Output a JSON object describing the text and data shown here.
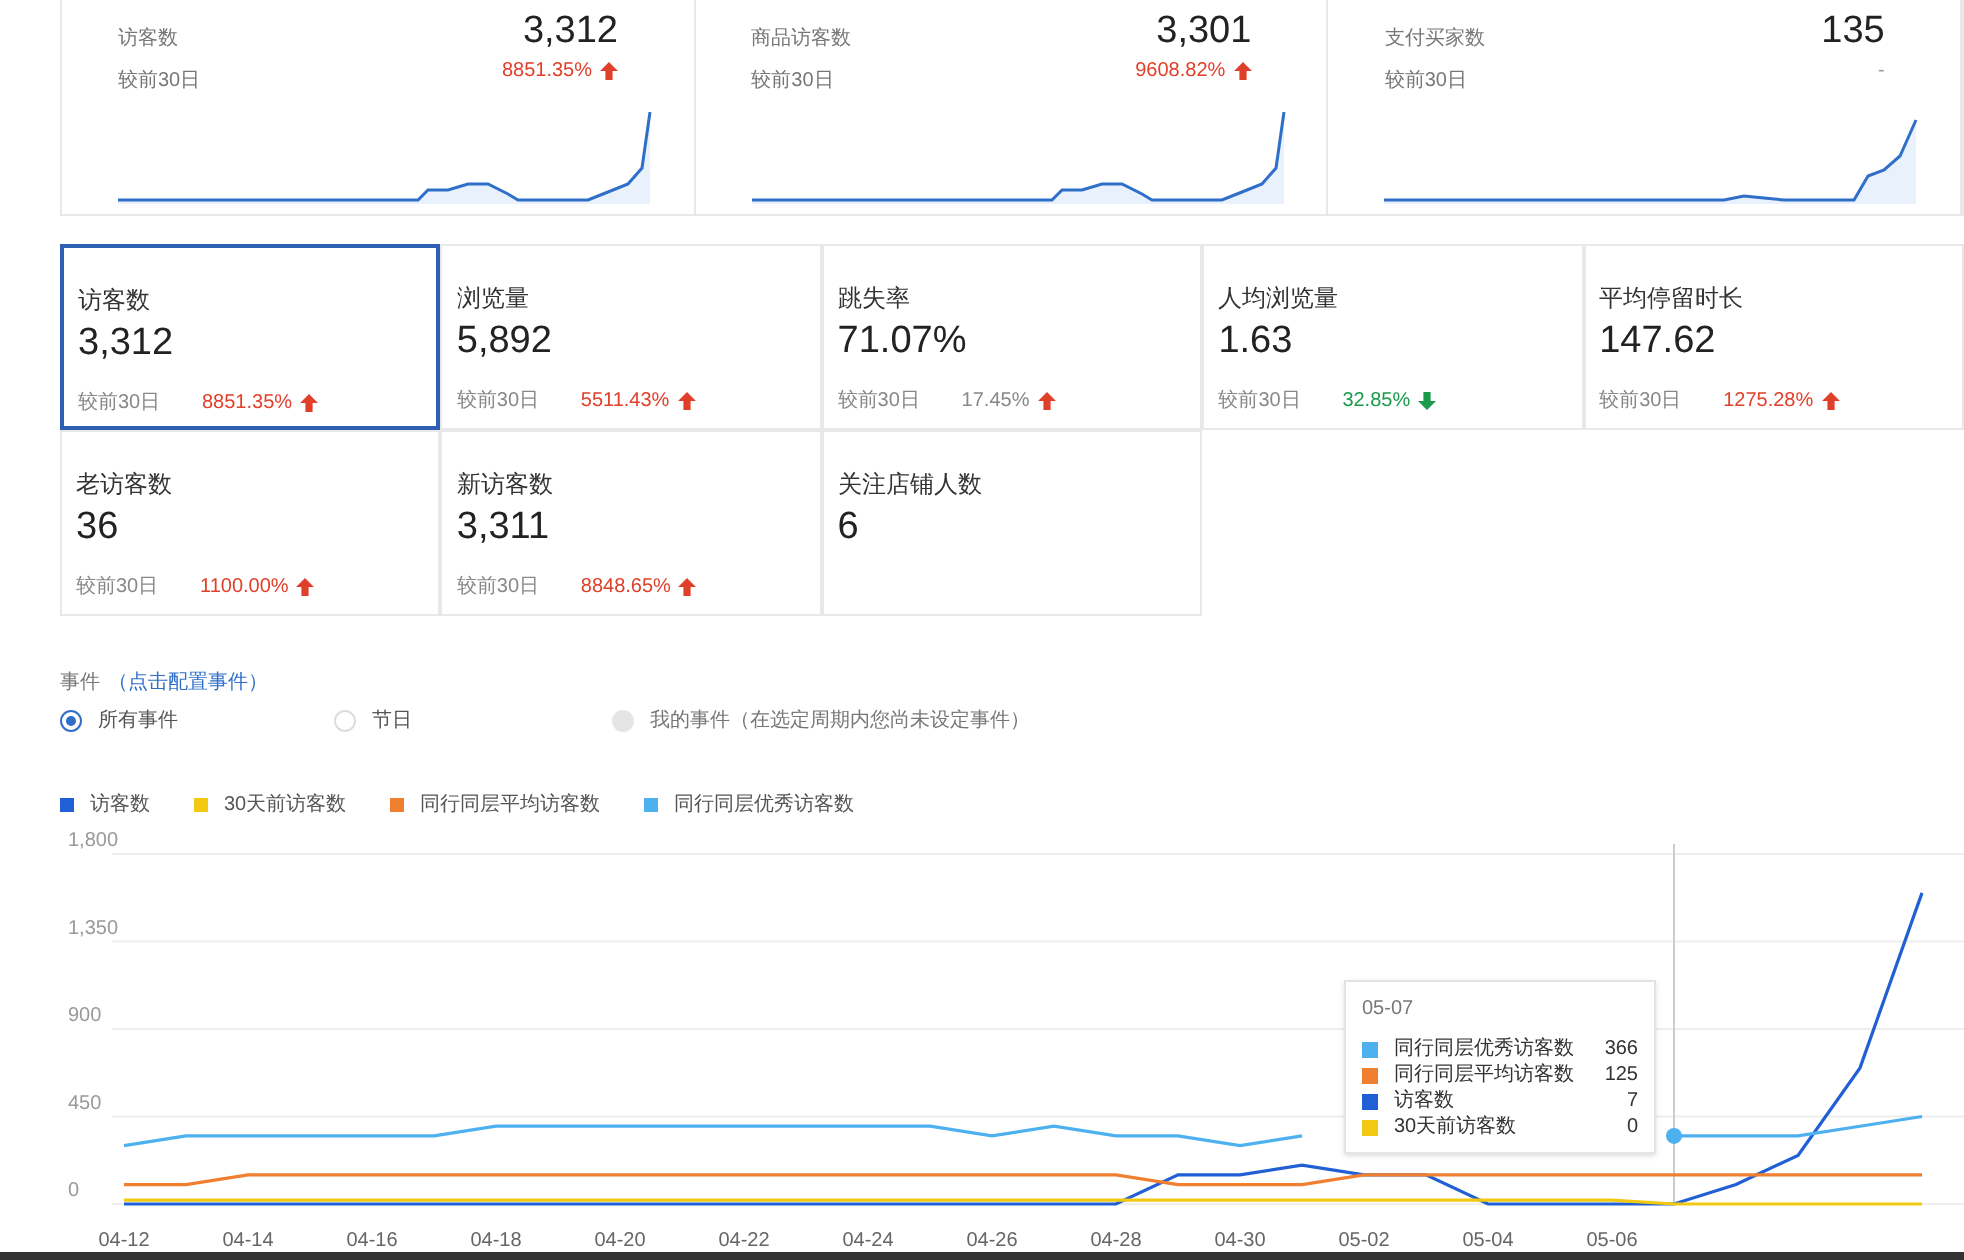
{
  "summary_cards": [
    {
      "label": "访客数",
      "value": "3,312",
      "compare_label": "较前30日",
      "change": "8851.35%",
      "increase": true
    },
    {
      "label": "商品访客数",
      "value": "3,301",
      "compare_label": "较前30日",
      "change": "9608.82%",
      "increase": true
    },
    {
      "label": "支付买家数",
      "value": "135",
      "compare_label": "较前30日",
      "change": "-"
    }
  ],
  "metrics": [
    {
      "label": "访客数",
      "value": "3,312",
      "compare_label": "较前30日",
      "change": "8851.35%",
      "increase": true,
      "color": "#e0402a",
      "selected": true
    },
    {
      "label": "浏览量",
      "value": "5,892",
      "compare_label": "较前30日",
      "change": "5511.43%",
      "increase": true,
      "color": "#e0402a",
      "selected": false
    },
    {
      "label": "跳失率",
      "value": "71.07%",
      "compare_label": "较前30日",
      "change": "17.45%",
      "increase": true,
      "color": "#888888",
      "selected": false
    },
    {
      "label": "人均浏览量",
      "value": "1.63",
      "compare_label": "较前30日",
      "change": "32.85%",
      "increase": false,
      "color": "#1a9a4a",
      "selected": false
    },
    {
      "label": "平均停留时长",
      "value": "147.62",
      "compare_label": "较前30日",
      "change": "1275.28%",
      "increase": true,
      "color": "#e0402a",
      "selected": false
    },
    {
      "label": "老访客数",
      "value": "36",
      "compare_label": "较前30日",
      "change": "1100.00%",
      "increase": true,
      "color": "#e0402a",
      "selected": false
    },
    {
      "label": "新访客数",
      "value": "3,311",
      "compare_label": "较前30日",
      "change": "8848.65%",
      "increase": true,
      "color": "#e0402a",
      "selected": false
    },
    {
      "label": "关注店铺人数",
      "value": "6",
      "selected": false
    }
  ],
  "events": {
    "title": "事件",
    "link": "（点击配置事件）",
    "options": [
      {
        "label": "所有事件",
        "selected": true,
        "disabled": false
      },
      {
        "label": "节日",
        "selected": false,
        "disabled": false
      },
      {
        "label": "我的事件（在选定周期内您尚未设定事件）",
        "selected": false,
        "disabled": true
      }
    ]
  },
  "chart": {
    "chart_data": {
      "type": "line",
      "grid": true,
      "categories": [
        "04-12",
        null,
        "04-14",
        null,
        "04-16",
        null,
        "04-18",
        null,
        "04-20",
        null,
        "04-22",
        null,
        "04-24",
        null,
        "04-26",
        null,
        "04-28",
        null,
        "04-30",
        null,
        "05-02",
        null,
        "05-04",
        null,
        "05-06",
        null,
        null,
        null,
        null,
        null
      ],
      "series": [
        {
          "name": "访客数",
          "color": "#2160d4",
          "values": [
            0,
            0,
            0,
            0,
            0,
            0,
            0,
            0,
            0,
            0,
            0,
            0,
            0,
            0,
            0,
            0,
            0,
            150,
            150,
            200,
            150,
            150,
            0,
            0,
            0,
            0,
            100,
            250,
            700,
            1600
          ]
        },
        {
          "name": "30天前访客数",
          "color": "#f2c811",
          "values": [
            20,
            20,
            20,
            20,
            20,
            20,
            20,
            20,
            20,
            20,
            20,
            20,
            20,
            20,
            20,
            20,
            20,
            20,
            20,
            20,
            20,
            20,
            20,
            20,
            20,
            0,
            0,
            0,
            0,
            0
          ]
        },
        {
          "name": "同行同层平均访客数",
          "color": "#f08030",
          "values": [
            100,
            100,
            150,
            150,
            150,
            150,
            150,
            150,
            150,
            150,
            150,
            150,
            150,
            150,
            150,
            150,
            150,
            100,
            100,
            100,
            150,
            150,
            150,
            150,
            150,
            150,
            150,
            150,
            150,
            150
          ]
        },
        {
          "name": "同行同层优秀访客数",
          "color": "#4db1ef",
          "values": [
            300,
            350,
            350,
            350,
            350,
            350,
            400,
            400,
            400,
            400,
            400,
            400,
            400,
            400,
            350,
            400,
            350,
            350,
            300,
            350,
            null,
            null,
            null,
            null,
            null,
            350,
            350,
            350,
            400,
            450
          ]
        }
      ],
      "ylim": [
        0,
        1800
      ],
      "yticks": [
        {
          "value": 0,
          "label": "0"
        },
        450,
        900,
        {
          "value": 1350,
          "label": "1,350"
        },
        {
          "value": 1800,
          "label": "1,800"
        }
      ]
    },
    "tooltip": {
      "date": "05-07",
      "rows": [
        {
          "name": "同行同层优秀访客数",
          "value": "366",
          "color": "#4db1ef"
        },
        {
          "name": "同行同层平均访客数",
          "value": "125",
          "color": "#f08030"
        },
        {
          "name": "访客数",
          "value": "7",
          "color": "#2160d4"
        },
        {
          "name": "30天前访客数",
          "value": "0",
          "color": "#f2c811"
        }
      ]
    }
  }
}
